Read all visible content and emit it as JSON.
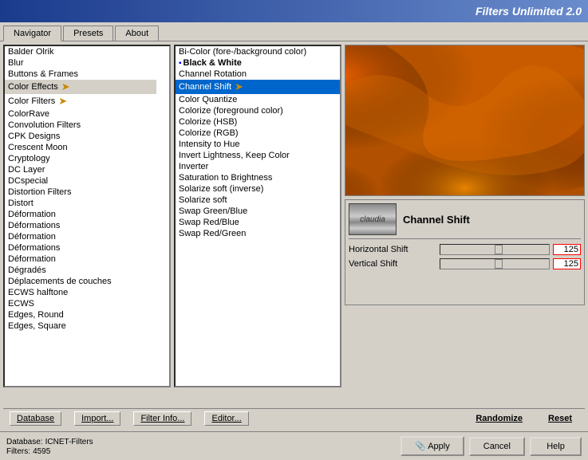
{
  "titleBar": {
    "title": "Filters Unlimited 2.0"
  },
  "tabs": [
    {
      "id": "navigator",
      "label": "Navigator",
      "active": true
    },
    {
      "id": "presets",
      "label": "Presets",
      "active": false
    },
    {
      "id": "about",
      "label": "About",
      "active": false
    }
  ],
  "leftPanel": {
    "items": [
      {
        "label": "Balder Olrik",
        "selected": false
      },
      {
        "label": "Blur",
        "selected": false
      },
      {
        "label": "Buttons & Frames",
        "selected": false
      },
      {
        "label": "Color Effects",
        "selected": true,
        "hasArrow": true
      },
      {
        "label": "Color Filters",
        "selected": false,
        "hasArrow": true
      },
      {
        "label": "ColorRave",
        "selected": false
      },
      {
        "label": "Convolution Filters",
        "selected": false
      },
      {
        "label": "CPK Designs",
        "selected": false
      },
      {
        "label": "Crescent Moon",
        "selected": false
      },
      {
        "label": "Cryptology",
        "selected": false
      },
      {
        "label": "DC Layer",
        "selected": false
      },
      {
        "label": "DCspecial",
        "selected": false
      },
      {
        "label": "Distortion Filters",
        "selected": false
      },
      {
        "label": "Distort",
        "selected": false
      },
      {
        "label": "Déformation",
        "selected": false
      },
      {
        "label": "Déformations",
        "selected": false
      },
      {
        "label": "Déformation",
        "selected": false
      },
      {
        "label": "Déformations",
        "selected": false
      },
      {
        "label": "Déformation",
        "selected": false
      },
      {
        "label": "Dégradés",
        "selected": false
      },
      {
        "label": "Déplacements de couches",
        "selected": false
      },
      {
        "label": "ECWS halftone",
        "selected": false
      },
      {
        "label": "ECWS",
        "selected": false
      },
      {
        "label": "Edges, Round",
        "selected": false
      },
      {
        "label": "Edges, Square",
        "selected": false
      }
    ]
  },
  "middlePanel": {
    "items": [
      {
        "label": "Bi-Color (fore-/background color)",
        "selected": false
      },
      {
        "label": "Black & White",
        "selected": false,
        "isSeparator": true
      },
      {
        "label": "Channel Rotation",
        "selected": false
      },
      {
        "label": "Channel Shift",
        "selected": true,
        "hasArrow": true
      },
      {
        "label": "Color Quantize",
        "selected": false
      },
      {
        "label": "Colorize (foreground color)",
        "selected": false
      },
      {
        "label": "Colorize (HSB)",
        "selected": false
      },
      {
        "label": "Colorize (RGB)",
        "selected": false
      },
      {
        "label": "Intensity to Hue",
        "selected": false
      },
      {
        "label": "Invert Lightness, Keep Color",
        "selected": false
      },
      {
        "label": "Inverter",
        "selected": false
      },
      {
        "label": "Saturation to Brightness",
        "selected": false
      },
      {
        "label": "Solarize soft (inverse)",
        "selected": false
      },
      {
        "label": "Solarize soft",
        "selected": false
      },
      {
        "label": "Swap Green/Blue",
        "selected": false
      },
      {
        "label": "Swap Red/Blue",
        "selected": false
      },
      {
        "label": "Swap Red/Green",
        "selected": false
      }
    ]
  },
  "filterControls": {
    "pluginLogo": "claudia",
    "filterName": "Channel Shift",
    "sliders": [
      {
        "label": "Horizontal Shift",
        "value": 125
      },
      {
        "label": "Vertical Shift",
        "value": 125
      }
    ]
  },
  "toolbar": {
    "items": [
      {
        "label": "Database",
        "underline": true
      },
      {
        "label": "Import...",
        "underline": true
      },
      {
        "label": "Filter Info...",
        "underline": true
      },
      {
        "label": "Editor...",
        "underline": true
      },
      {
        "label": "Randomize"
      },
      {
        "label": "Reset"
      }
    ]
  },
  "statusBar": {
    "databaseLabel": "Database:",
    "databaseValue": "ICNET-Filters",
    "filtersLabel": "Filters:",
    "filtersValue": "4595"
  },
  "actionButtons": [
    {
      "label": "Apply",
      "id": "apply"
    },
    {
      "label": "Cancel",
      "id": "cancel"
    },
    {
      "label": "Help",
      "id": "help"
    }
  ]
}
